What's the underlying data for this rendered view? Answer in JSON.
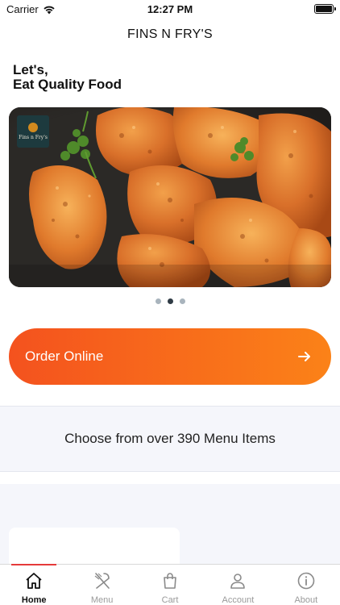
{
  "status_bar": {
    "carrier": "Carrier",
    "time": "12:27 PM"
  },
  "nav": {
    "title": "FINS N FRY'S"
  },
  "greeting": {
    "line1": "Let's,",
    "line2": "Eat Quality Food"
  },
  "hero": {
    "logo_text": "Fins n Fry's",
    "slide_count": 3,
    "active_slide": 1
  },
  "order_button": {
    "label": "Order Online"
  },
  "menu_banner": {
    "text": "Choose from over 390 Menu Items"
  },
  "tab_bar": {
    "items": [
      {
        "label": "Home",
        "icon": "home-icon",
        "active": true
      },
      {
        "label": "Menu",
        "icon": "fork-knife-icon",
        "active": false
      },
      {
        "label": "Cart",
        "icon": "shopping-bag-icon",
        "active": false
      },
      {
        "label": "Account",
        "icon": "person-icon",
        "active": false
      },
      {
        "label": "About",
        "icon": "info-icon",
        "active": false
      }
    ]
  },
  "colors": {
    "accent_start": "#f4521e",
    "accent_end": "#fb8218",
    "tab_indicator": "#e53a3a"
  }
}
